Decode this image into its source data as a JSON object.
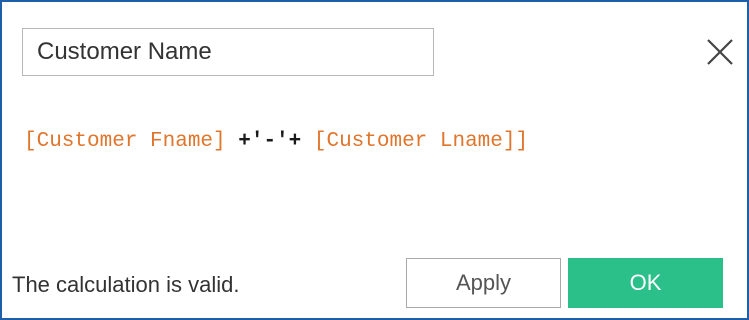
{
  "dialog": {
    "name_field_value": "Customer Name",
    "close_icon": "close-icon"
  },
  "formula": {
    "field_1": "[Customer Fname]",
    "operator_1": " +'-'+ ",
    "field_2": "[Customer Lname]",
    "trailing": "]"
  },
  "footer": {
    "status_text": "The calculation is valid.",
    "apply_label": "Apply",
    "ok_label": "OK"
  },
  "colors": {
    "field_reference": "#e0752c",
    "ok_button": "#2bbf8a",
    "border": "#1f5fa8"
  }
}
